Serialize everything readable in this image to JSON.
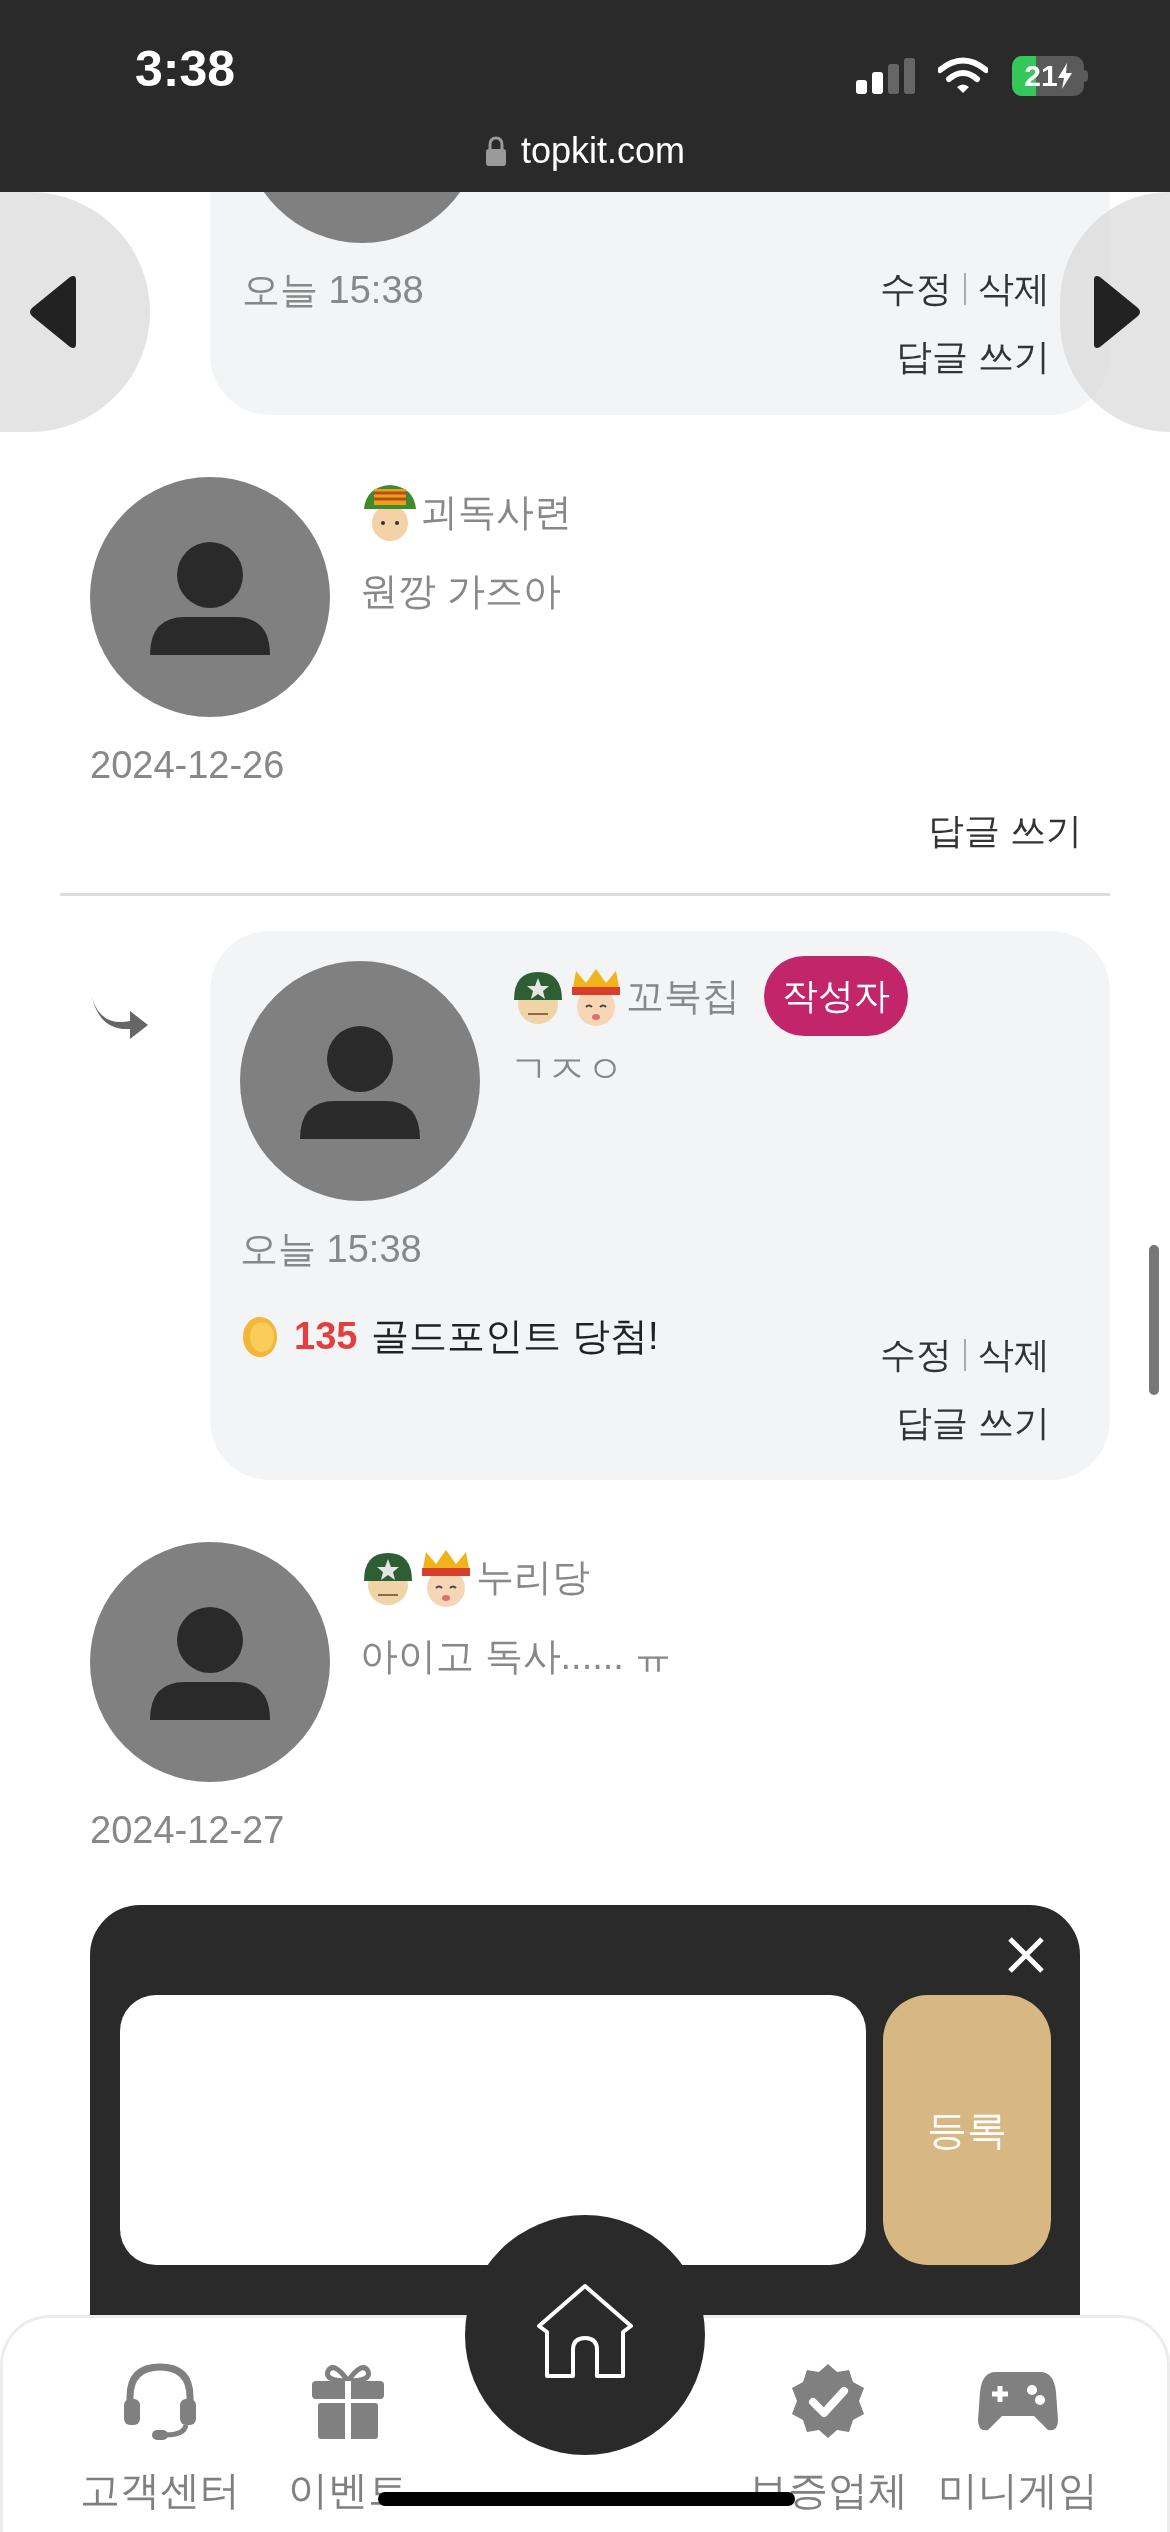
{
  "status_bar": {
    "time": "3:38",
    "battery": "21"
  },
  "address_bar": {
    "url": "topkit.com"
  },
  "previous_reply": {
    "date": "오늘 15:38",
    "actions": [
      "수정",
      "삭제"
    ],
    "reply_link": "답글 쓰기"
  },
  "comments": [
    {
      "is_reply": false,
      "badges": [
        {
          "kind": "camo_hat"
        }
      ],
      "author": "괴독사련",
      "text": "원깡 가즈아",
      "date": "2024-12-26",
      "reply_link": "답글 쓰기",
      "divider_after": true
    },
    {
      "is_reply": true,
      "badges": [
        {
          "kind": "helmet"
        },
        {
          "kind": "crown"
        }
      ],
      "author": "꼬북칩",
      "author_tag": "작성자",
      "text": "ㄱㅈㅇ",
      "date": "오늘 15:38",
      "reward": {
        "amount": "135",
        "label": "골드포인트 당첨!"
      },
      "actions": [
        "수정",
        "삭제"
      ],
      "reply_link": "답글 쓰기",
      "divider_after": false
    },
    {
      "is_reply": false,
      "badges": [
        {
          "kind": "helmet"
        },
        {
          "kind": "crown"
        }
      ],
      "author": "누리당",
      "text": "아이고 독사...... ㅠ",
      "date": "2024-12-27",
      "divider_after": false
    }
  ],
  "composer": {
    "submit": "등록"
  },
  "bottom_nav": [
    {
      "kind": "headset",
      "label": "고객센터"
    },
    {
      "kind": "gift",
      "label": "이벤트"
    },
    {
      "kind": "home"
    },
    {
      "kind": "verified",
      "label": "보증업체"
    },
    {
      "kind": "gamepad",
      "label": "미니게임"
    }
  ]
}
